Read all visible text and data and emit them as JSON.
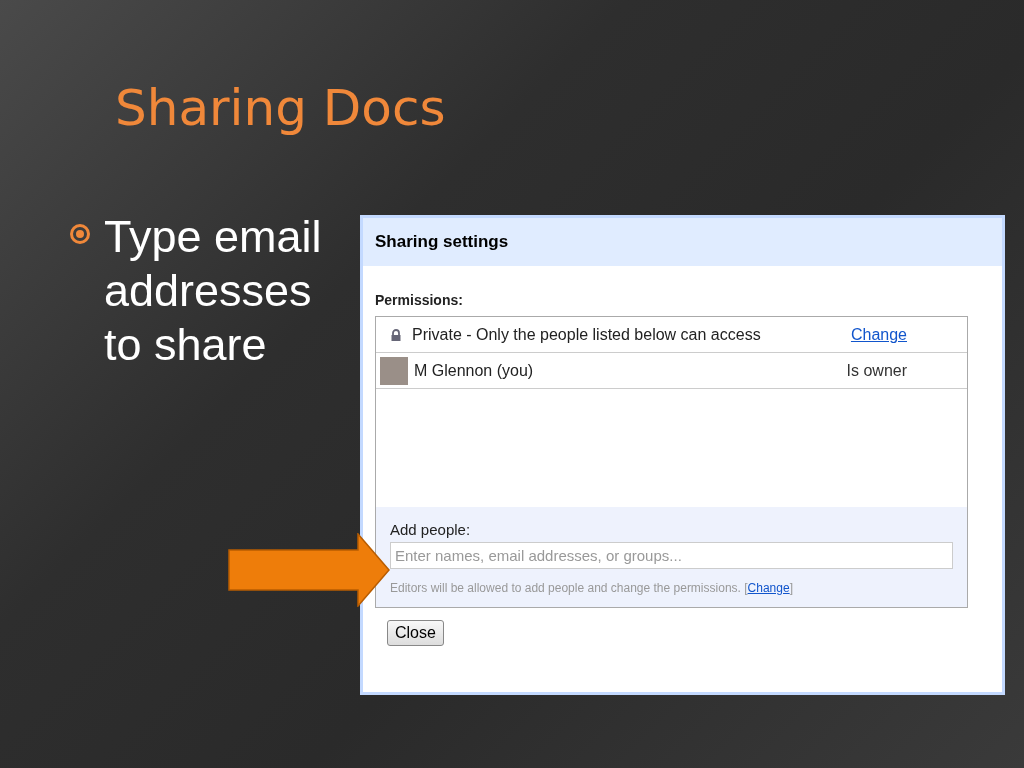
{
  "slide": {
    "title": "Sharing Docs",
    "bullets": [
      "Type email addresses to share"
    ]
  },
  "dialog": {
    "title": "Sharing settings",
    "permissions_label": "Permissions:",
    "visibility": {
      "text": "Private - Only the people listed below can access",
      "link": "Change"
    },
    "people": [
      {
        "name": "M Glennon (you)",
        "role": "Is owner"
      }
    ],
    "add_people": {
      "label": "Add people:",
      "placeholder": "Enter names, email addresses, or groups...",
      "note": "Editors will be allowed to add people and change the permissions.",
      "note_link_open": "[",
      "note_link": "Change",
      "note_link_close": "]"
    },
    "buttons": [
      "Close"
    ]
  }
}
